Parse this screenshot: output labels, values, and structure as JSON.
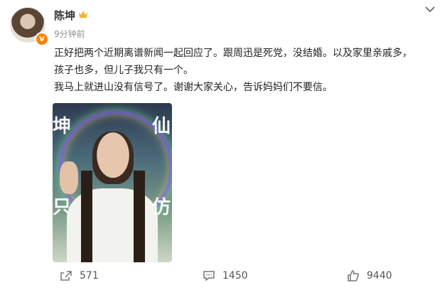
{
  "author": {
    "name": "陈坤",
    "badge": "V",
    "time": "9分钟前"
  },
  "post": {
    "lines": [
      "正好把两个近期离谱新闻一起回应了。跟周迅是死党，没结婚。以及家里亲戚多，",
      "孩子也多，但儿子我只有一个。",
      "我马上就进山没有信号了。谢谢大家关心，告诉妈妈们不要信。"
    ]
  },
  "image": {
    "overlay_chars": [
      "坤",
      "仙",
      "只",
      "仿"
    ]
  },
  "actions": {
    "repost_count": "571",
    "comment_count": "1450",
    "like_count": "9440"
  },
  "colors": {
    "accent": "#ff8200",
    "crown": "#f5b335",
    "muted": "#939393"
  }
}
